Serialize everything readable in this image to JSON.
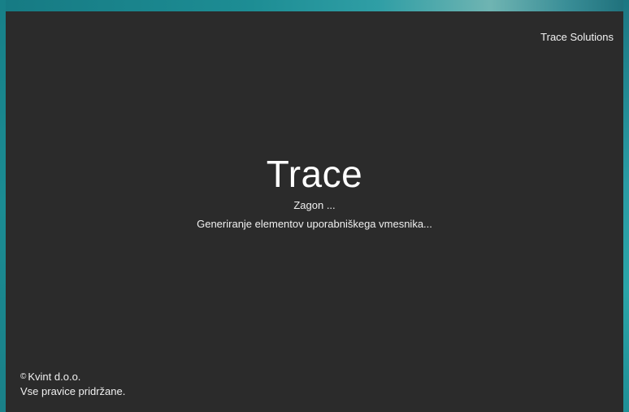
{
  "brand": {
    "corner_label": "Trace Solutions"
  },
  "splash": {
    "title": "Trace",
    "status": "Zagon ...",
    "detail": "Generiranje elementov uporabniškega vmesnika..."
  },
  "footer": {
    "copyright_symbol": "©",
    "company": "Kvint d.o.o.",
    "rights": "Vse pravice pridržane."
  },
  "colors": {
    "background": "#2b2b2b",
    "text": "#ffffff",
    "desktop_accent": "#2aa3a6"
  }
}
